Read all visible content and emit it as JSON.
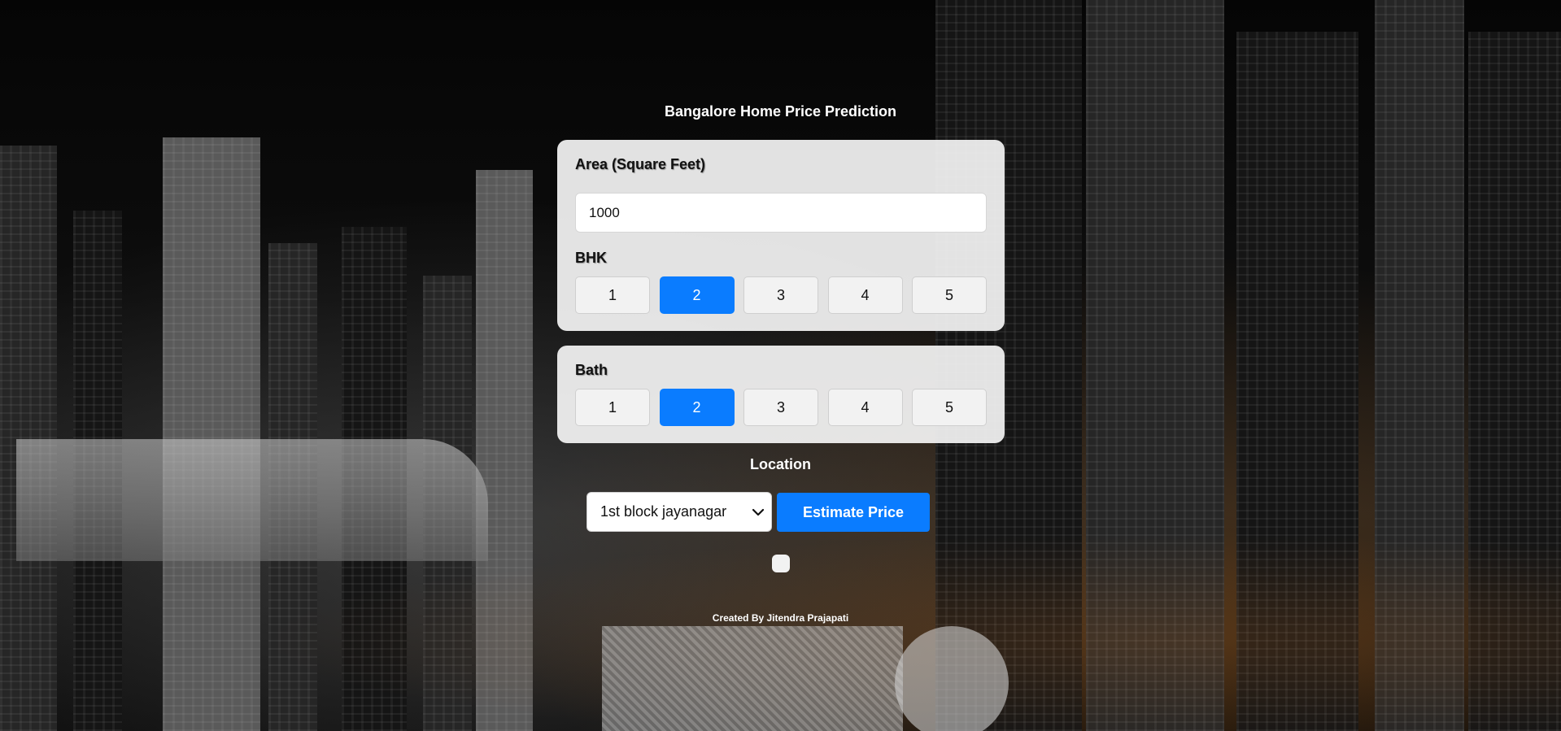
{
  "page": {
    "title": "Bangalore Home Price Prediction",
    "credit": "Created By Jitendra Prajapati"
  },
  "area": {
    "label": "Area (Square Feet)",
    "value": "1000"
  },
  "bhk": {
    "label": "BHK",
    "options": [
      "1",
      "2",
      "3",
      "4",
      "5"
    ],
    "selected": "2"
  },
  "bath": {
    "label": "Bath",
    "options": [
      "1",
      "2",
      "3",
      "4",
      "5"
    ],
    "selected": "2"
  },
  "location": {
    "label": "Location",
    "selected": "1st block jayanagar"
  },
  "actions": {
    "estimate_label": "Estimate Price"
  },
  "colors": {
    "accent": "#0a7cff",
    "panel": "#f5f5f5",
    "text_light": "#ffffff"
  },
  "icons": {
    "location_dropdown": "chevron-down-icon"
  }
}
